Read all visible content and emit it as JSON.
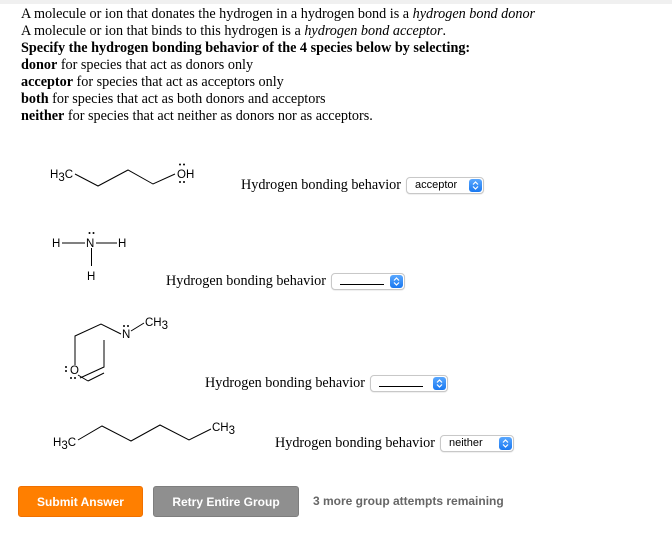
{
  "instructions": {
    "line1_text": "A molecule or ion that donates the hydrogen in a hydrogen bond is a ",
    "line1_italic": "hydrogen bond donor",
    "line2_text": "A molecule or ion that binds to this hydrogen is a ",
    "line2_italic": "hydrogen bond acceptor",
    "line2_end": ".",
    "line3_bold": "Specify the hydrogen bonding behavior of the 4 species below by selecting:",
    "options": [
      {
        "term": "donor",
        "desc": " for species that act as donors only"
      },
      {
        "term": "acceptor",
        "desc": " for species that act as acceptors only"
      },
      {
        "term": "both",
        "desc": " for species that act as both donors and acceptors"
      },
      {
        "term": "neither",
        "desc": " for species that act neither as donors nor as acceptors."
      }
    ]
  },
  "species": [
    {
      "name": "1-butanol",
      "labels": {
        "left": "H",
        "left_sub": "3",
        "left_end": "C",
        "right": "OH"
      },
      "prompt": "Hydrogen bonding behavior",
      "selected": "acceptor"
    },
    {
      "name": "ammonia",
      "labels": {
        "h": "H",
        "n": "N"
      },
      "prompt": "Hydrogen bonding behavior",
      "selected": ""
    },
    {
      "name": "N-methylmorpholine",
      "labels": {
        "ch": "CH",
        "ch_sub": "3",
        "n": "N",
        "o": "O"
      },
      "prompt": "Hydrogen bonding behavior",
      "selected": ""
    },
    {
      "name": "hexane",
      "labels": {
        "left": "H",
        "left_sub": "3",
        "left_end": "C",
        "right": "CH",
        "right_sub": "3"
      },
      "prompt": "Hydrogen bonding behavior",
      "selected": "neither"
    }
  ],
  "actions": {
    "submit_label": "Submit Answer",
    "retry_label": "Retry Entire Group",
    "attempts_text": "3 more group attempts remaining"
  },
  "colors": {
    "submit": "#ff7f00",
    "retry": "#8f8f8f",
    "select_arrow": "#1a78f0"
  }
}
